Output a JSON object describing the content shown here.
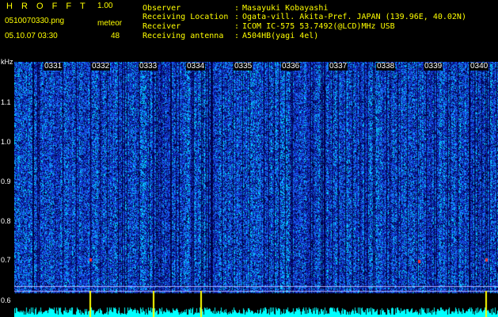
{
  "header": {
    "app_title": "H R O F F T",
    "version": "1.00",
    "filename": "0510070330.png",
    "meteor_label": "meteor",
    "datetime": "05.10.07 03:30",
    "meteor_count": "48"
  },
  "info": [
    {
      "label": "Observer",
      "value": "Masayuki Kobayashi"
    },
    {
      "label": "Receiving Location",
      "value": "Ogata-vill. Akita-Pref. JAPAN (139.96E, 40.02N)"
    },
    {
      "label": "Receiver",
      "value": "ICOM IC-575 53.7492(@LCD)MHz USB"
    },
    {
      "label": "Receiving antenna",
      "value": "A504HB(yagi 4el)"
    }
  ],
  "separator": ":",
  "axis": {
    "y_unit": "kHz",
    "y_ticks": [
      "1.1",
      "1.0",
      "0.9",
      "0.8",
      "0.7",
      "0.6"
    ],
    "x_ticks": [
      "0331",
      "0332",
      "0333",
      "0334",
      "0335",
      "0336",
      "0337",
      "0338",
      "0339",
      "0340"
    ]
  },
  "colors": {
    "text": "#ffff00",
    "axis_text": "#ffffff",
    "background": "#000000",
    "spectrum_low": "#00008b",
    "spectrum_mid": "#1e50ff",
    "spectrum_high": "#00ffff",
    "meteor": "#ff3030",
    "histogram": "#00ffff",
    "histogram_peak": "#ffff00"
  }
}
